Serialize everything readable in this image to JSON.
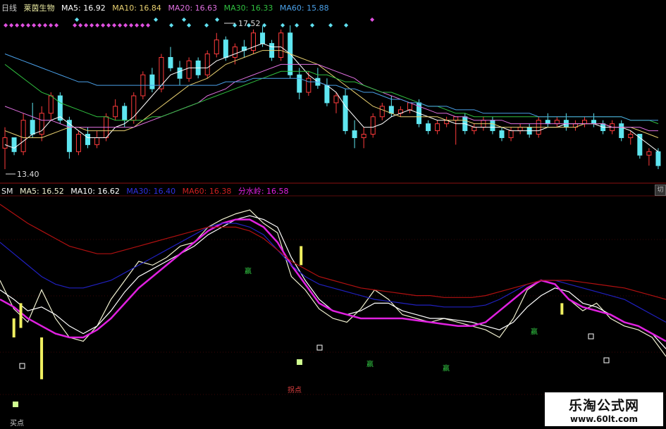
{
  "header_top": {
    "period": "日线",
    "stock": "莱茵生物",
    "ma5": "MA5: 16.92",
    "ma10": "MA10: 16.84",
    "ma20": "MA20: 16.63",
    "ma30": "MA30: 16.33",
    "ma60": "MA60: 15.88"
  },
  "header_bottom": {
    "name": "SM",
    "ma5": "MA5: 16.52",
    "ma10": "MA10: 16.62",
    "ma30": "MA30: 16.40",
    "ma60": "MA60: 16.38",
    "watershed": "分水岭: 16.58"
  },
  "watermark": {
    "title": "乐淘公式网",
    "url": "www.60lt.com"
  },
  "scroll_label": "切",
  "colors": {
    "up": "#ff3b3b",
    "down": "#5fe6f0",
    "ma5": "#ffffff",
    "ma10": "#e8d070",
    "ma20": "#e070e0",
    "ma30": "#30c040",
    "ma60": "#4aa0e8",
    "magenta": "#e020e0",
    "blue": "#2020c0",
    "darkred": "#b01010",
    "bar": "#f0f060"
  },
  "chart_data": [
    {
      "type": "candlestick",
      "title": "莱茵生物 日线",
      "high_label": "17.52",
      "low_label": "13.40",
      "ylim": [
        13.2,
        17.8
      ],
      "candles": [
        [
          14.0,
          14.6,
          13.4,
          14.3
        ],
        [
          14.3,
          14.3,
          13.8,
          13.9
        ],
        [
          13.9,
          15.0,
          13.8,
          14.8
        ],
        [
          14.8,
          15.3,
          14.3,
          14.4
        ],
        [
          14.4,
          15.2,
          14.2,
          15.0
        ],
        [
          15.0,
          15.6,
          14.8,
          15.5
        ],
        [
          15.5,
          15.6,
          14.7,
          14.8
        ],
        [
          14.8,
          14.9,
          13.7,
          13.9
        ],
        [
          13.9,
          14.5,
          13.8,
          14.4
        ],
        [
          14.4,
          14.6,
          14.0,
          14.1
        ],
        [
          14.1,
          14.5,
          14.0,
          14.3
        ],
        [
          14.3,
          15.0,
          14.2,
          14.9
        ],
        [
          14.9,
          15.4,
          14.8,
          15.2
        ],
        [
          15.2,
          15.3,
          14.6,
          14.8
        ],
        [
          14.8,
          15.6,
          14.7,
          15.5
        ],
        [
          15.5,
          16.2,
          15.4,
          16.1
        ],
        [
          16.1,
          16.3,
          15.6,
          15.7
        ],
        [
          15.7,
          16.7,
          15.6,
          16.6
        ],
        [
          16.6,
          16.9,
          16.2,
          16.3
        ],
        [
          16.3,
          16.5,
          15.8,
          16.0
        ],
        [
          16.0,
          16.6,
          15.9,
          16.5
        ],
        [
          16.5,
          16.6,
          16.0,
          16.1
        ],
        [
          16.1,
          16.8,
          16.0,
          16.7
        ],
        [
          16.7,
          17.3,
          16.6,
          17.1
        ],
        [
          17.1,
          17.2,
          16.5,
          16.6
        ],
        [
          16.6,
          17.0,
          16.4,
          16.9
        ],
        [
          16.9,
          17.1,
          16.6,
          16.8
        ],
        [
          16.8,
          17.4,
          16.7,
          17.3
        ],
        [
          17.3,
          17.5,
          16.9,
          17.0
        ],
        [
          17.0,
          17.1,
          16.5,
          16.6
        ],
        [
          16.6,
          17.4,
          16.5,
          17.3
        ],
        [
          17.3,
          17.52,
          16.0,
          16.1
        ],
        [
          16.1,
          16.3,
          15.4,
          15.6
        ],
        [
          15.6,
          16.2,
          15.5,
          16.0
        ],
        [
          16.0,
          16.3,
          15.7,
          15.8
        ],
        [
          15.8,
          16.0,
          15.2,
          15.3
        ],
        [
          15.3,
          15.6,
          15.0,
          15.5
        ],
        [
          15.5,
          15.7,
          14.4,
          14.5
        ],
        [
          14.5,
          14.8,
          14.0,
          14.3
        ],
        [
          14.3,
          14.6,
          14.0,
          14.4
        ],
        [
          14.4,
          15.0,
          14.3,
          14.9
        ],
        [
          14.9,
          15.3,
          14.8,
          15.2
        ],
        [
          15.2,
          15.5,
          14.9,
          15.0
        ],
        [
          15.0,
          15.2,
          14.9,
          15.1
        ],
        [
          15.1,
          15.3,
          15.0,
          15.3
        ],
        [
          15.3,
          15.4,
          14.6,
          14.7
        ],
        [
          14.7,
          14.8,
          14.4,
          14.5
        ],
        [
          14.5,
          14.8,
          14.4,
          14.7
        ],
        [
          14.7,
          14.9,
          14.6,
          14.8
        ],
        [
          14.8,
          14.9,
          14.1,
          14.9
        ],
        [
          14.9,
          15.0,
          14.4,
          14.5
        ],
        [
          14.5,
          14.7,
          14.4,
          14.6
        ],
        [
          14.6,
          14.9,
          14.5,
          14.8
        ],
        [
          14.8,
          14.9,
          14.4,
          14.5
        ],
        [
          14.5,
          14.6,
          14.2,
          14.3
        ],
        [
          14.3,
          14.6,
          14.2,
          14.5
        ],
        [
          14.5,
          14.7,
          14.4,
          14.6
        ],
        [
          14.6,
          14.7,
          14.3,
          14.4
        ],
        [
          14.4,
          14.9,
          14.3,
          14.8
        ],
        [
          14.8,
          15.0,
          14.6,
          14.7
        ],
        [
          14.7,
          14.9,
          14.6,
          14.8
        ],
        [
          14.8,
          15.0,
          14.5,
          14.6
        ],
        [
          14.6,
          14.8,
          14.5,
          14.7
        ],
        [
          14.7,
          14.9,
          14.6,
          14.8
        ],
        [
          14.8,
          15.0,
          14.6,
          14.7
        ],
        [
          14.7,
          14.8,
          14.4,
          14.5
        ],
        [
          14.5,
          14.8,
          14.4,
          14.7
        ],
        [
          14.7,
          14.8,
          14.2,
          14.3
        ],
        [
          14.3,
          14.5,
          14.1,
          14.4
        ],
        [
          14.4,
          14.4,
          13.7,
          13.8
        ],
        [
          13.8,
          14.0,
          13.5,
          13.9
        ],
        [
          13.9,
          14.0,
          13.4,
          13.5
        ]
      ],
      "ma": [
        {
          "name": "MA5",
          "color": "#ffffff",
          "values": [
            14.1,
            14.0,
            14.2,
            14.4,
            14.5,
            14.8,
            14.9,
            14.7,
            14.5,
            14.3,
            14.3,
            14.3,
            14.6,
            14.7,
            14.9,
            15.2,
            15.5,
            15.8,
            16.1,
            16.2,
            16.3,
            16.3,
            16.3,
            16.5,
            16.6,
            16.7,
            16.8,
            16.9,
            17.0,
            16.9,
            16.9,
            16.7,
            16.4,
            16.1,
            15.9,
            15.8,
            15.6,
            15.2,
            14.9,
            14.6,
            14.6,
            14.7,
            14.9,
            15.0,
            15.1,
            15.0,
            14.9,
            14.8,
            14.8,
            14.7,
            14.7,
            14.6,
            14.6,
            14.6,
            14.6,
            14.5,
            14.5,
            14.5,
            14.5,
            14.6,
            14.6,
            14.7,
            14.7,
            14.7,
            14.7,
            14.6,
            14.6,
            14.6,
            14.5,
            14.3,
            14.1,
            13.9
          ]
        },
        {
          "name": "MA10",
          "color": "#e8d070",
          "values": [
            14.5,
            14.4,
            14.3,
            14.3,
            14.3,
            14.4,
            14.5,
            14.6,
            14.6,
            14.5,
            14.5,
            14.5,
            14.5,
            14.5,
            14.6,
            14.8,
            15.0,
            15.2,
            15.4,
            15.6,
            15.8,
            15.9,
            16.0,
            16.2,
            16.4,
            16.5,
            16.6,
            16.7,
            16.8,
            16.8,
            16.8,
            16.7,
            16.6,
            16.5,
            16.4,
            16.2,
            16.0,
            15.8,
            15.6,
            15.4,
            15.2,
            15.1,
            15.0,
            14.9,
            14.9,
            14.9,
            14.9,
            14.9,
            14.8,
            14.8,
            14.8,
            14.7,
            14.7,
            14.7,
            14.6,
            14.6,
            14.6,
            14.6,
            14.6,
            14.6,
            14.6,
            14.6,
            14.6,
            14.7,
            14.7,
            14.7,
            14.6,
            14.6,
            14.6,
            14.5,
            14.4,
            14.3
          ]
        },
        {
          "name": "MA20",
          "color": "#e070e0",
          "values": [
            15.2,
            15.1,
            15.0,
            14.9,
            14.8,
            14.8,
            14.7,
            14.6,
            14.6,
            14.6,
            14.6,
            14.6,
            14.6,
            14.6,
            14.6,
            14.7,
            14.8,
            14.9,
            15.0,
            15.1,
            15.2,
            15.3,
            15.5,
            15.6,
            15.7,
            15.9,
            16.0,
            16.1,
            16.2,
            16.3,
            16.4,
            16.4,
            16.4,
            16.4,
            16.4,
            16.3,
            16.2,
            16.1,
            16.0,
            15.8,
            15.7,
            15.6,
            15.5,
            15.4,
            15.3,
            15.2,
            15.1,
            15.0,
            15.0,
            14.9,
            14.9,
            14.8,
            14.8,
            14.8,
            14.8,
            14.7,
            14.7,
            14.7,
            14.7,
            14.7,
            14.7,
            14.7,
            14.7,
            14.7,
            14.7,
            14.7,
            14.6,
            14.6,
            14.6,
            14.6,
            14.5,
            14.5
          ]
        },
        {
          "name": "MA30",
          "color": "#30c040",
          "values": [
            16.4,
            16.2,
            16.0,
            15.8,
            15.6,
            15.5,
            15.3,
            15.2,
            15.1,
            15.0,
            14.9,
            14.9,
            14.8,
            14.8,
            14.8,
            14.8,
            14.9,
            14.9,
            15.0,
            15.1,
            15.2,
            15.3,
            15.4,
            15.5,
            15.6,
            15.7,
            15.8,
            15.9,
            16.0,
            16.1,
            16.2,
            16.2,
            16.2,
            16.2,
            16.1,
            16.1,
            16.0,
            15.9,
            15.9,
            15.8,
            15.7,
            15.6,
            15.6,
            15.5,
            15.4,
            15.3,
            15.2,
            15.2,
            15.1,
            15.0,
            15.0,
            14.9,
            14.9,
            14.9,
            14.9,
            14.9,
            14.9,
            14.9,
            14.9,
            14.9,
            14.9,
            14.9,
            14.9,
            14.9,
            14.9,
            14.9,
            14.9,
            14.9,
            14.8,
            14.8,
            14.8,
            14.7
          ]
        },
        {
          "name": "MA60",
          "color": "#4aa0e8",
          "values": [
            16.7,
            16.6,
            16.5,
            16.4,
            16.3,
            16.2,
            16.1,
            16.0,
            15.9,
            15.9,
            15.8,
            15.8,
            15.8,
            15.8,
            15.8,
            15.8,
            15.8,
            15.8,
            15.8,
            15.8,
            15.8,
            15.8,
            15.8,
            15.8,
            15.9,
            15.9,
            15.9,
            16.0,
            16.0,
            16.0,
            16.0,
            16.0,
            16.0,
            15.9,
            15.9,
            15.8,
            15.8,
            15.7,
            15.7,
            15.6,
            15.6,
            15.5,
            15.4,
            15.4,
            15.3,
            15.3,
            15.2,
            15.2,
            15.2,
            15.1,
            15.1,
            15.1,
            15.0,
            15.0,
            15.0,
            15.0,
            15.0,
            15.0,
            14.9,
            14.9,
            14.9,
            14.9,
            14.9,
            14.9,
            14.9,
            14.9,
            14.9,
            14.9,
            14.8,
            14.8,
            14.8,
            14.8
          ]
        }
      ]
    },
    {
      "type": "line",
      "title": "SM",
      "ylim": [
        0,
        100
      ],
      "series": [
        {
          "name": "MA5",
          "color": "#f0f0d0",
          "values": [
            60,
            45,
            38,
            55,
            40,
            30,
            28,
            36,
            50,
            60,
            70,
            68,
            72,
            78,
            80,
            88,
            92,
            95,
            97,
            90,
            85,
            62,
            55,
            45,
            40,
            38,
            45,
            55,
            50,
            42,
            40,
            38,
            40,
            38,
            36,
            34,
            30,
            40,
            55,
            60,
            58,
            50,
            44,
            48,
            40,
            36,
            34,
            30,
            20
          ]
        },
        {
          "name": "MA10",
          "color": "#ffffff",
          "values": [
            55,
            50,
            44,
            46,
            42,
            36,
            32,
            36,
            44,
            54,
            62,
            66,
            70,
            74,
            78,
            84,
            88,
            92,
            94,
            92,
            88,
            72,
            60,
            50,
            44,
            42,
            44,
            48,
            48,
            44,
            42,
            40,
            40,
            39,
            38,
            36,
            34,
            38,
            46,
            52,
            56,
            54,
            48,
            46,
            42,
            38,
            36,
            32,
            24
          ]
        },
        {
          "name": "分水岭",
          "color": "#e020e0",
          "values": [
            50,
            46,
            40,
            36,
            32,
            30,
            30,
            34,
            40,
            48,
            56,
            62,
            68,
            74,
            80,
            86,
            90,
            92,
            92,
            88,
            80,
            68,
            58,
            48,
            44,
            42,
            40,
            40,
            40,
            40,
            39,
            38,
            37,
            36,
            36,
            38,
            44,
            50,
            56,
            60,
            58,
            50,
            46,
            44,
            42,
            38,
            36,
            32,
            28
          ]
        },
        {
          "name": "MA30",
          "color": "#2020c0",
          "values": [
            80,
            74,
            68,
            62,
            58,
            56,
            56,
            58,
            60,
            64,
            68,
            72,
            76,
            80,
            84,
            88,
            90,
            90,
            88,
            84,
            76,
            68,
            62,
            58,
            56,
            54,
            52,
            50,
            49,
            48,
            47,
            47,
            46,
            46,
            46,
            47,
            50,
            54,
            58,
            60,
            60,
            58,
            56,
            54,
            52,
            50,
            46,
            42,
            38
          ]
        },
        {
          "name": "MA60",
          "color": "#b01010",
          "values": [
            100,
            95,
            90,
            86,
            82,
            78,
            76,
            74,
            74,
            76,
            78,
            80,
            82,
            84,
            86,
            88,
            88,
            88,
            86,
            82,
            76,
            70,
            66,
            62,
            60,
            58,
            56,
            55,
            54,
            53,
            52,
            52,
            51,
            51,
            51,
            52,
            54,
            56,
            58,
            60,
            60,
            60,
            59,
            58,
            57,
            56,
            54,
            52,
            50
          ]
        }
      ],
      "annotations": [
        "买点",
        "拐点",
        "赢"
      ],
      "bars": [
        {
          "x": 1,
          "from": 30,
          "to": 40
        },
        {
          "x": 1.5,
          "from": 35,
          "to": 48
        },
        {
          "x": 3,
          "from": 8,
          "to": 30
        },
        {
          "x": 21.7,
          "from": 68,
          "to": 78
        },
        {
          "x": 40.5,
          "from": 42,
          "to": 48
        }
      ]
    }
  ]
}
